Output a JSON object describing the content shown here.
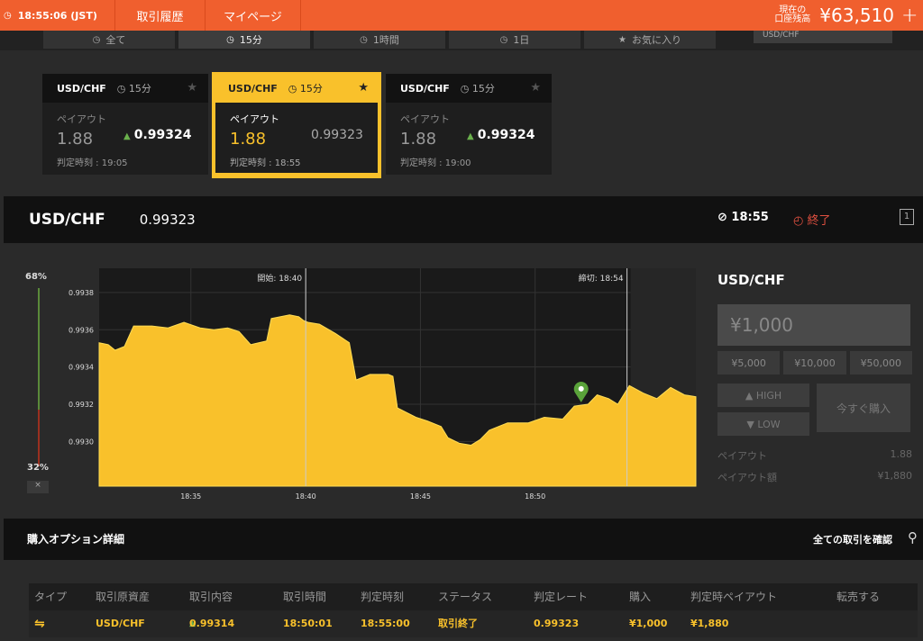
{
  "topbar": {
    "time": "18:55:06 (JST)",
    "nav": [
      "取引履歴",
      "マイページ"
    ],
    "balance_label_1": "現在の",
    "balance_label_2": "口座残高",
    "balance": "¥63,510",
    "plus": "+"
  },
  "timetabs": [
    {
      "label": "全て",
      "icon": "clock-icon"
    },
    {
      "label": "15分",
      "icon": "clock-icon",
      "active": true
    },
    {
      "label": "1時間",
      "icon": "clock-icon"
    },
    {
      "label": "1日",
      "icon": "clock-icon"
    },
    {
      "label": "お気に入り",
      "icon": "star-icon"
    }
  ],
  "search_text": "USD/CHF",
  "cards": [
    {
      "pair": "USD/CHF",
      "timeframe": "15分",
      "payout_label": "ペイアウト",
      "payout": "1.88",
      "rate": "0.99324",
      "judge": "判定時刻 : 19:05"
    },
    {
      "pair": "USD/CHF",
      "timeframe": "15分",
      "payout_label": "ペイアウト",
      "payout": "1.88",
      "rate": "0.99323",
      "judge": "判定時刻 : 18:55",
      "active": true
    },
    {
      "pair": "USD/CHF",
      "timeframe": "15分",
      "payout_label": "ペイアウト",
      "payout": "1.88",
      "rate": "0.99324",
      "judge": "判定時刻 : 19:00"
    }
  ],
  "pairbar": {
    "pair": "USD/CHF",
    "price": "0.99323",
    "expiry": "18:55",
    "status": "終了",
    "expand": "1"
  },
  "meter": {
    "high_pct": "68%",
    "low_pct": "32%",
    "high_frac": 0.68,
    "close": "×"
  },
  "chart_data": {
    "type": "area",
    "x_ticks": [
      "18:35",
      "18:40",
      "18:45",
      "18:50"
    ],
    "y_ticks": [
      "0.9938",
      "0.9936",
      "0.9934",
      "0.9932",
      "0.9930"
    ],
    "y_tick_values": [
      0.9938,
      0.9936,
      0.9934,
      0.9932,
      0.993
    ],
    "ylim": [
      0.99276,
      0.99393
    ],
    "xlim": [
      18.5167,
      18.95
    ],
    "start_label": "開始: 18:40",
    "end_label": "締切: 18:54",
    "start_x": 18.6667,
    "end_x": 18.9,
    "color": "#f9c12b",
    "marker_x": 18.8667,
    "marker_y": 0.99321,
    "series": [
      {
        "values": [
          [
            18.5167,
            0.99353
          ],
          [
            18.5233,
            0.99352
          ],
          [
            18.5283,
            0.99349
          ],
          [
            18.535,
            0.99351
          ],
          [
            18.5417,
            0.99362
          ],
          [
            18.555,
            0.99362
          ],
          [
            18.5667,
            0.99361
          ],
          [
            18.5783,
            0.99364
          ],
          [
            18.59,
            0.99361
          ],
          [
            18.6,
            0.9936
          ],
          [
            18.61,
            0.99361
          ],
          [
            18.6183,
            0.99359
          ],
          [
            18.6267,
            0.99352
          ],
          [
            18.6383,
            0.99354
          ],
          [
            18.6417,
            0.99366
          ],
          [
            18.655,
            0.99368
          ],
          [
            18.6617,
            0.99367
          ],
          [
            18.665,
            0.99365
          ],
          [
            18.6683,
            0.99364
          ],
          [
            18.6767,
            0.99363
          ],
          [
            18.6883,
            0.99358
          ],
          [
            18.6983,
            0.99353
          ],
          [
            18.7033,
            0.99333
          ],
          [
            18.7133,
            0.99336
          ],
          [
            18.7267,
            0.99336
          ],
          [
            18.73,
            0.99335
          ],
          [
            18.7333,
            0.99318
          ],
          [
            18.7467,
            0.99313
          ],
          [
            18.755,
            0.99311
          ],
          [
            18.765,
            0.99308
          ],
          [
            18.77,
            0.99302
          ],
          [
            18.7783,
            0.99299
          ],
          [
            18.7867,
            0.99298
          ],
          [
            18.7933,
            0.99301
          ],
          [
            18.8,
            0.99306
          ],
          [
            18.8133,
            0.9931
          ],
          [
            18.8283,
            0.9931
          ],
          [
            18.84,
            0.99313
          ],
          [
            18.8533,
            0.99312
          ],
          [
            18.8617,
            0.99319
          ],
          [
            18.8717,
            0.9932
          ],
          [
            18.8783,
            0.99325
          ],
          [
            18.8867,
            0.99323
          ],
          [
            18.8933,
            0.9932
          ],
          [
            18.9017,
            0.9933
          ],
          [
            18.9117,
            0.99326
          ],
          [
            18.9217,
            0.99323
          ],
          [
            18.9317,
            0.99329
          ],
          [
            18.9417,
            0.99325
          ],
          [
            18.95,
            0.99324
          ]
        ]
      }
    ]
  },
  "order": {
    "pair": "USD/CHF",
    "amount": "¥1,000",
    "quick": [
      "¥5,000",
      "¥10,000",
      "¥50,000"
    ],
    "high": "HIGH",
    "low": "LOW",
    "buy_now": "今すぐ購入",
    "payout_label": "ペイアウト",
    "payout": "1.88",
    "payout_amt_label": "ペイアウト額",
    "payout_amt": "¥1,880"
  },
  "details": {
    "title": "購入オプション詳細",
    "link": "全ての取引を確認"
  },
  "table": {
    "headers": [
      "タイプ",
      "取引原資産",
      "取引内容",
      "取引時間",
      "判定時刻",
      "ステータス",
      "判定レート",
      "購入",
      "判定時ペイアウト",
      "転売する"
    ],
    "row": {
      "asset": "USD/CHF",
      "content": "0.99314",
      "time": "18:50:01",
      "judge": "18:55:00",
      "status": "取引終了",
      "rate": "0.99323",
      "buy": "¥1,000",
      "payout": "¥1,880"
    }
  }
}
